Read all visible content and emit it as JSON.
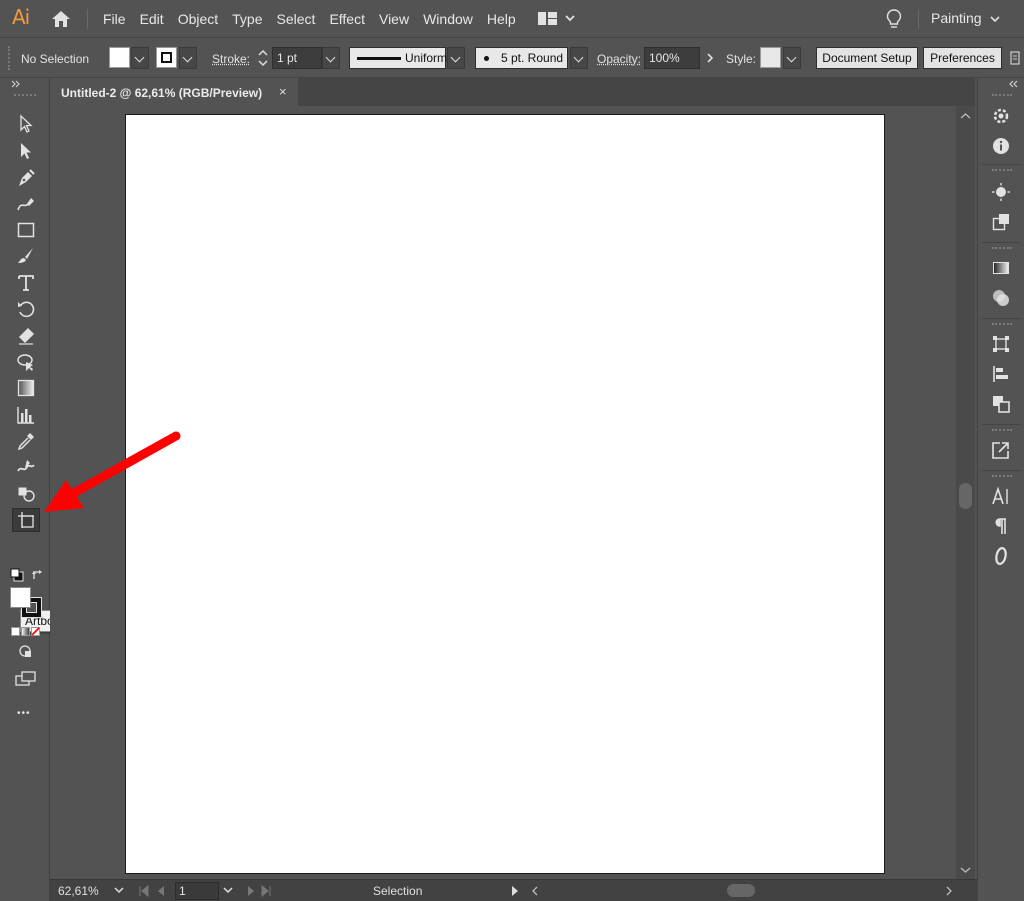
{
  "app": {
    "logo": "Ai",
    "accent_color": "#f29a3a",
    "arrow_color": "#ff0000"
  },
  "menu": {
    "items": [
      "File",
      "Edit",
      "Object",
      "Type",
      "Select",
      "Effect",
      "View",
      "Window",
      "Help"
    ],
    "workspace": "Painting"
  },
  "control": {
    "selection_status": "No Selection",
    "stroke_label": "Stroke:",
    "stroke_weight": "1 pt",
    "stroke_profile": "Uniform",
    "brush": "5 pt. Round",
    "opacity_label": "Opacity:",
    "opacity_value": "100%",
    "style_label": "Style:",
    "document_setup": "Document Setup",
    "preferences": "Preferences"
  },
  "document": {
    "tab_title": "Untitled-2 @ 62,61% (RGB/Preview)",
    "close_glyph": "×"
  },
  "tooltip": {
    "text": "Artboard Tool (Shift+O)"
  },
  "status": {
    "zoom": "62,61%",
    "artboard_number": "1",
    "current_tool": "Selection"
  },
  "toolbar": {
    "more_glyph": "•••"
  },
  "icons": {
    "tools": [
      "selection-icon",
      "direct-selection-icon",
      "pen-icon",
      "curvature-icon",
      "rectangle-icon",
      "paintbrush-icon",
      "type-icon",
      "rotate-icon",
      "eraser-icon",
      "lasso-icon",
      "gradient-icon",
      "graph-icon",
      "eyedropper-icon",
      "width-icon",
      "shape-builder-icon",
      "artboard-icon"
    ],
    "dock": [
      "properties-icon",
      "info-icon",
      "color-guide-icon",
      "libraries-icon",
      "gradient-panel-icon",
      "transparency-icon",
      "transform-icon",
      "align-icon",
      "pathfinder-icon",
      "export-icon",
      "character-icon",
      "paragraph-icon",
      "opentype-icon"
    ]
  }
}
